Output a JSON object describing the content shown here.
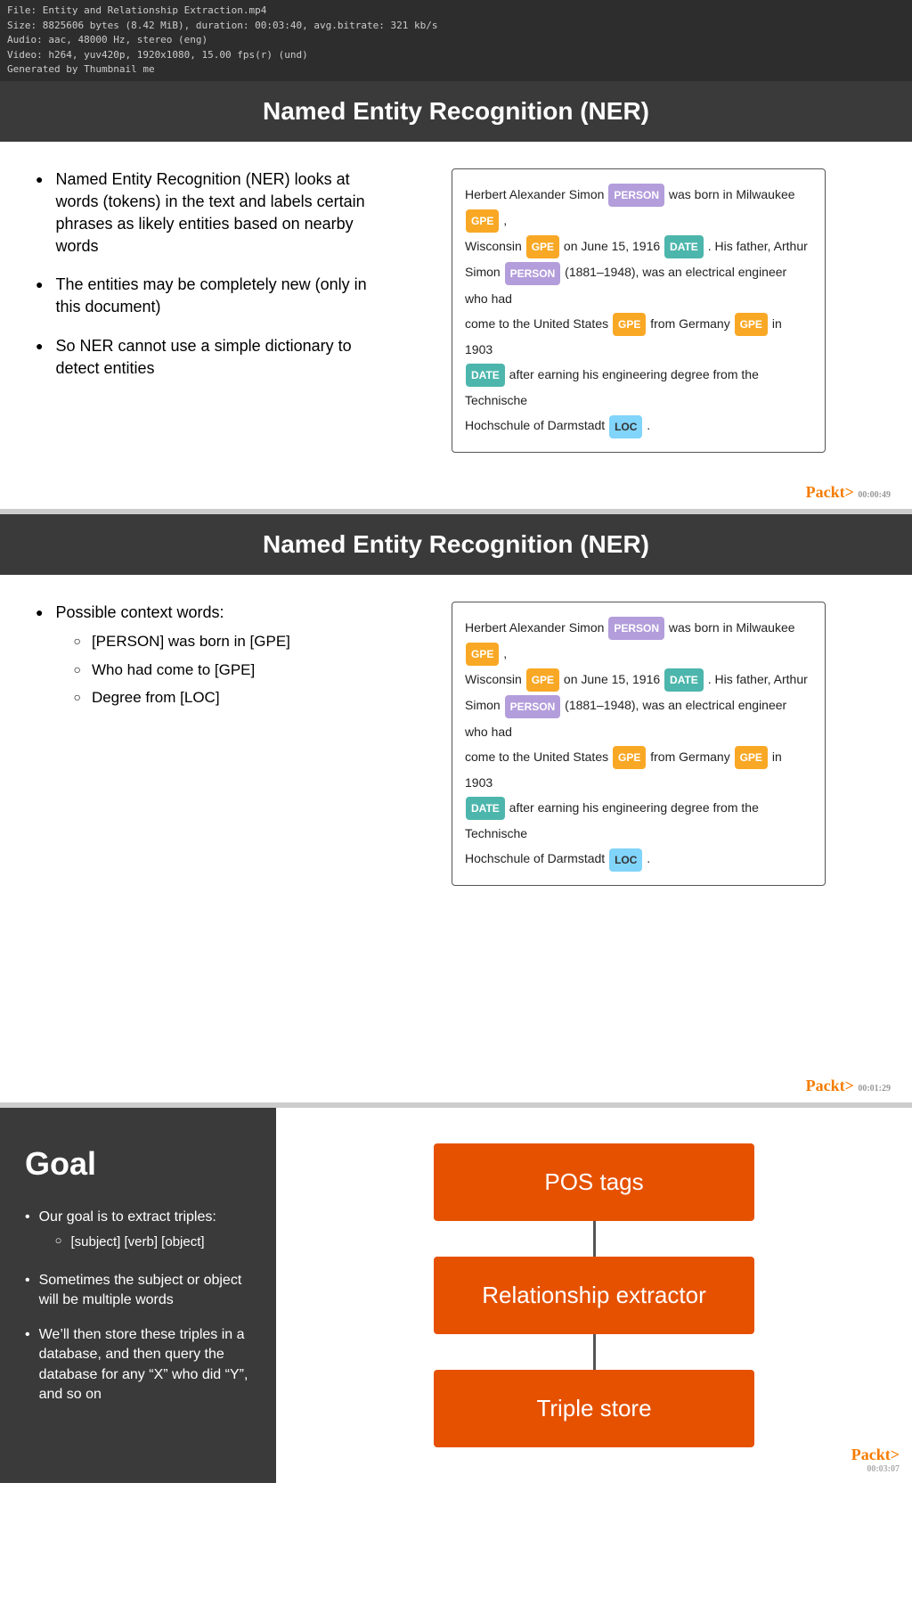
{
  "fileinfo": {
    "line1": "File: Entity and Relationship Extraction.mp4",
    "line2": "Size: 8825606 bytes (8.42 MiB), duration: 00:03:40, avg.bitrate: 321 kb/s",
    "line3": "Audio: aac, 48000 Hz, stereo (eng)",
    "line4": "Video: h264, yuv420p, 1920x1080, 15.00 fps(r) (und)",
    "line5": "Generated by Thumbnail me"
  },
  "slide1": {
    "title": "Named Entity Recognition (NER)",
    "bullets": [
      "Named Entity Recognition (NER) looks at words (tokens) in the text and labels certain phrases as likely entities based on nearby words",
      "The entities may be completely new (only in this document)",
      "So NER cannot use a simple dictionary to detect entities"
    ],
    "timestamp": "00:00:49"
  },
  "slide2": {
    "title": "Named Entity Recognition (NER)",
    "heading": "Possible context words:",
    "sub_bullets": [
      "[PERSON] was born in [GPE]",
      "Who had come to [GPE]",
      "Degree from [LOC]"
    ],
    "timestamp": "00:01:29"
  },
  "slide3": {
    "goal_title": "Goal",
    "bullets": [
      {
        "text": "Our goal is to extract triples:",
        "subs": [
          "[subject] [verb] [object]"
        ]
      },
      {
        "text": "Sometimes the subject or object will be multiple words",
        "subs": []
      },
      {
        "text": "We’ll then store these triples in a database, and then query the database for any “X” who did “Y”, and so on",
        "subs": []
      }
    ],
    "flowchart": [
      "POS tags",
      "Relationship extractor",
      "Triple store"
    ],
    "packt_logo": "Packt>",
    "timestamp": "00:03:07"
  },
  "ner_text": {
    "sentence1": "Herbert Alexander Simon",
    "tag_person1": "PERSON",
    "was_born": "was born in",
    "milwaukee": "Milwaukee",
    "tag_gpe1": "GPE",
    "comma1": ",",
    "wisconsin": "Wisconsin",
    "tag_gpe2": "GPE",
    "on": "on",
    "june": "June 15, 1916",
    "tag_date": "DATE",
    "dot1": ". His father,",
    "arthur": "Arthur",
    "simon2": "Simon",
    "tag_person2": "PERSON",
    "paren": "(1881–1948), was an electrical engineer who had come to",
    "us": "the United States",
    "tag_gpe3": "GPE",
    "from": "from",
    "germany": "Germany",
    "tag_gpe4": "GPE",
    "in": "in",
    "y1903": "1903",
    "tag_date2": "DATE",
    "after": "after earning his engineering degree from",
    "tech": "the Technische",
    "hochschule": "Hochschule of Darmstadt",
    "tag_loc": "LOC",
    "dot2": "."
  },
  "packt_logo": "Packt>"
}
